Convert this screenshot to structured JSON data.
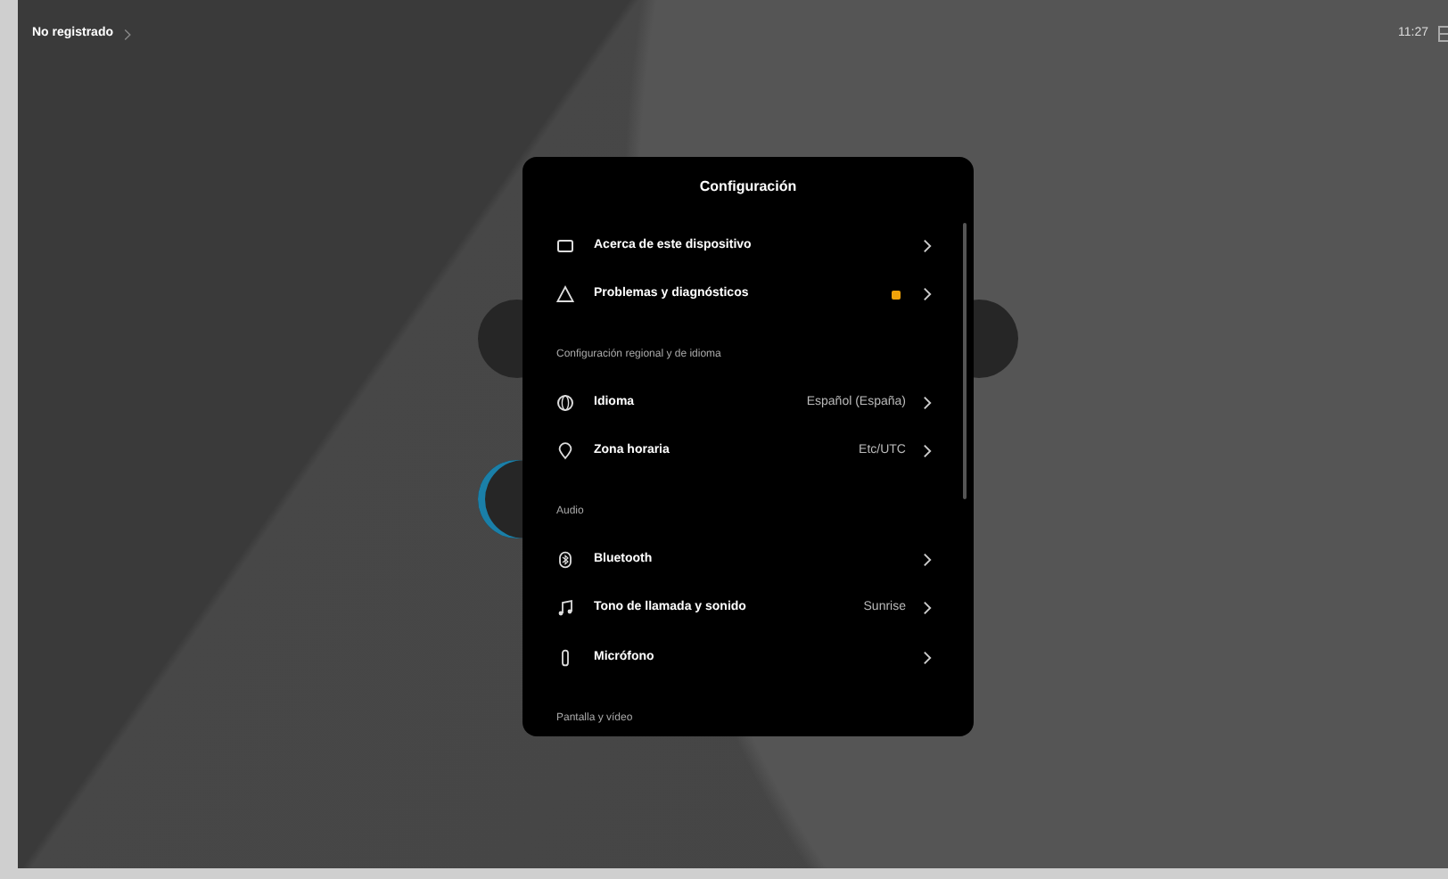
{
  "status_bar": {
    "registration": "No registrado",
    "time": "11:27"
  },
  "settings": {
    "title": "Configuración",
    "items": [
      {
        "kind": "item",
        "label": "Acerca de este dispositivo"
      },
      {
        "kind": "item",
        "label": "Problemas y diagnósticos",
        "color": "#f0a30a"
      },
      {
        "kind": "header",
        "label": "Configuración regional y de idioma"
      },
      {
        "kind": "item",
        "label": "Idioma",
        "value": "Español (España)"
      },
      {
        "kind": "item",
        "label": "Zona horaria",
        "value": "Etc/UTC"
      },
      {
        "kind": "header",
        "label": "Audio"
      },
      {
        "kind": "item",
        "label": "Bluetooth"
      },
      {
        "kind": "item",
        "label": "Tono de llamada y sonido",
        "value": "Sunrise"
      },
      {
        "kind": "item",
        "label": "Micrófono"
      },
      {
        "kind": "header",
        "label": "Pantalla y vídeo"
      }
    ]
  }
}
